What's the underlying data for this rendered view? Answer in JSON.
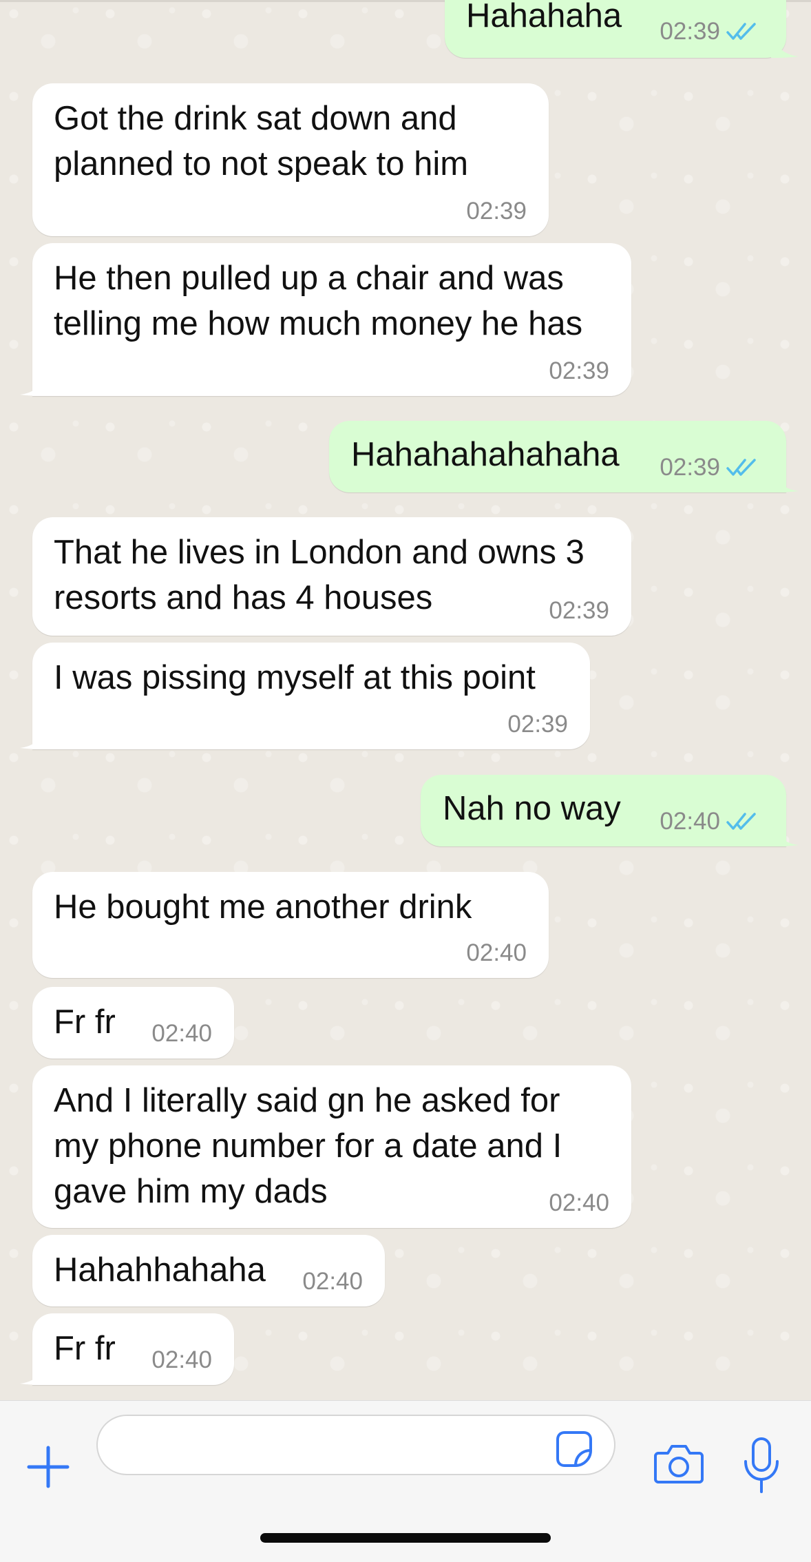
{
  "messages": [
    {
      "dir": "out",
      "text": "Hahahaha",
      "time": "02:39",
      "read": true
    },
    {
      "dir": "in",
      "text": "Got the drink sat down and\nplanned to not speak to him",
      "time": "02:39"
    },
    {
      "dir": "in",
      "text": "He then pulled up a chair and was\ntelling me how much money he has",
      "time": "02:39"
    },
    {
      "dir": "out",
      "text": "Hahahahahahaha",
      "time": "02:39",
      "read": true
    },
    {
      "dir": "in",
      "text": "That he lives in London and owns 3\nresorts and has 4 houses",
      "time": "02:39"
    },
    {
      "dir": "in",
      "text": "I was pissing myself at this point",
      "time": "02:39"
    },
    {
      "dir": "out",
      "text": "Nah no way",
      "time": "02:40",
      "read": true
    },
    {
      "dir": "in",
      "text": "He bought me another drink",
      "time": "02:40"
    },
    {
      "dir": "in",
      "text": "Fr fr",
      "time": "02:40"
    },
    {
      "dir": "in",
      "text": "And I literally said gn he asked for\nmy phone number for a date and I\ngave him my dads",
      "time": "02:40"
    },
    {
      "dir": "in",
      "text": "Hahahhahaha",
      "time": "02:40"
    },
    {
      "dir": "in",
      "text": "Fr fr",
      "time": "02:40"
    }
  ],
  "composer": {
    "placeholder": "",
    "icons": [
      "plus-icon",
      "sticker-icon",
      "camera-icon",
      "microphone-icon"
    ]
  },
  "colors": {
    "accent": "#3478f6",
    "incoming_bubble": "#ffffff",
    "outgoing_bubble": "#d9fdd3",
    "read_ticks": "#53bdeb",
    "timestamp": "#8a8a8a"
  }
}
